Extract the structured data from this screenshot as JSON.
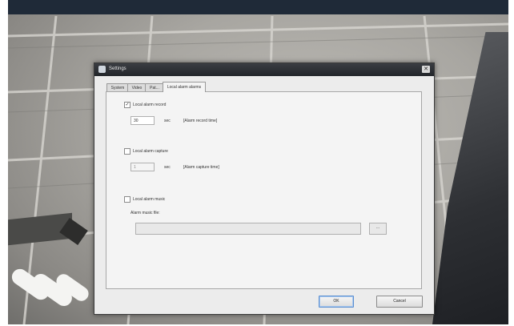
{
  "dialog": {
    "title": "Settings",
    "close_icon": "close-icon",
    "tabs": [
      {
        "label": "System"
      },
      {
        "label": "Video"
      },
      {
        "label": "Pat..."
      },
      {
        "label": "Local alarm alarms"
      }
    ],
    "active_tab": "Local alarm alarms",
    "local_alarm_record": {
      "label": "Local alarm record",
      "checked": true,
      "value": "30",
      "unit": "sec",
      "hint": "[Alarm record time]"
    },
    "local_alarm_capture": {
      "label": "Local alarm capture",
      "checked": false,
      "value": "1",
      "unit": "sec",
      "hint": "[Alarm capture time]"
    },
    "local_alarm_music": {
      "label": "Local alarm music",
      "checked": false,
      "file_label": "Alarm music file:",
      "file_value": "",
      "browse_label": "..."
    },
    "ok_label": "OK",
    "cancel_label": "Cancel"
  }
}
